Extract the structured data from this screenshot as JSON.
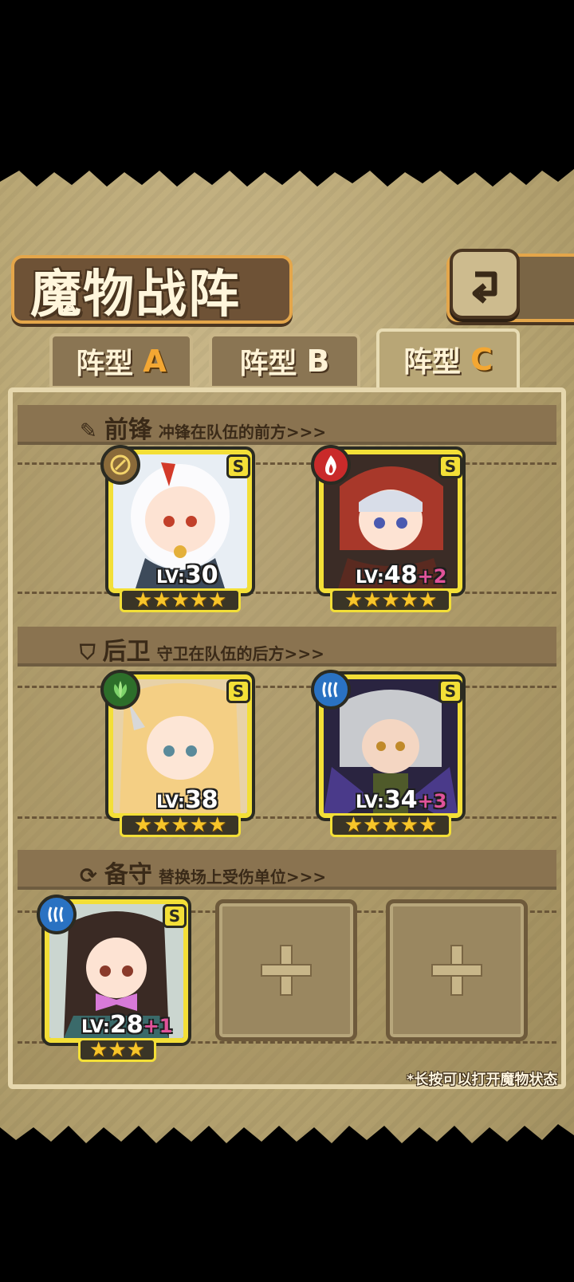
{
  "title": "魔物战阵",
  "tabs": [
    {
      "prefix": "阵型",
      "letter": "A"
    },
    {
      "prefix": "阵型",
      "letter": "B"
    },
    {
      "prefix": "阵型",
      "letter": "C"
    }
  ],
  "active_tab": "C",
  "sections": {
    "front": {
      "name": "前锋",
      "desc": "冲锋在队伍的前方>>>"
    },
    "rear": {
      "name": "后卫",
      "desc": "守卫在队伍的后方>>>"
    },
    "reserve": {
      "name": "备守",
      "desc": "替换场上受伤单位>>>"
    }
  },
  "units": [
    {
      "grade": "S",
      "element": "light",
      "lv_prefix": "LV:",
      "level": "30",
      "bonus": "",
      "stars": 5
    },
    {
      "grade": "S",
      "element": "fire",
      "lv_prefix": "LV:",
      "level": "48",
      "bonus": "+2",
      "stars": 5
    },
    {
      "grade": "S",
      "element": "nature",
      "lv_prefix": "LV:",
      "level": "38",
      "bonus": "",
      "stars": 5
    },
    {
      "grade": "S",
      "element": "water",
      "lv_prefix": "LV:",
      "level": "34",
      "bonus": "+3",
      "stars": 5
    },
    {
      "grade": "S",
      "element": "water",
      "lv_prefix": "LV:",
      "level": "28",
      "bonus": "+1",
      "stars": 3
    }
  ],
  "empty_slot_icon": "plus-icon",
  "hint": "*长按可以打开魔物状态",
  "colors": {
    "fire": "#c92a2a",
    "water": "#2a72c2",
    "nature": "#2d6e2a",
    "light": "#8a6a3a",
    "frame_yellow": "#f3df37",
    "accent_orange": "#f3a733"
  }
}
